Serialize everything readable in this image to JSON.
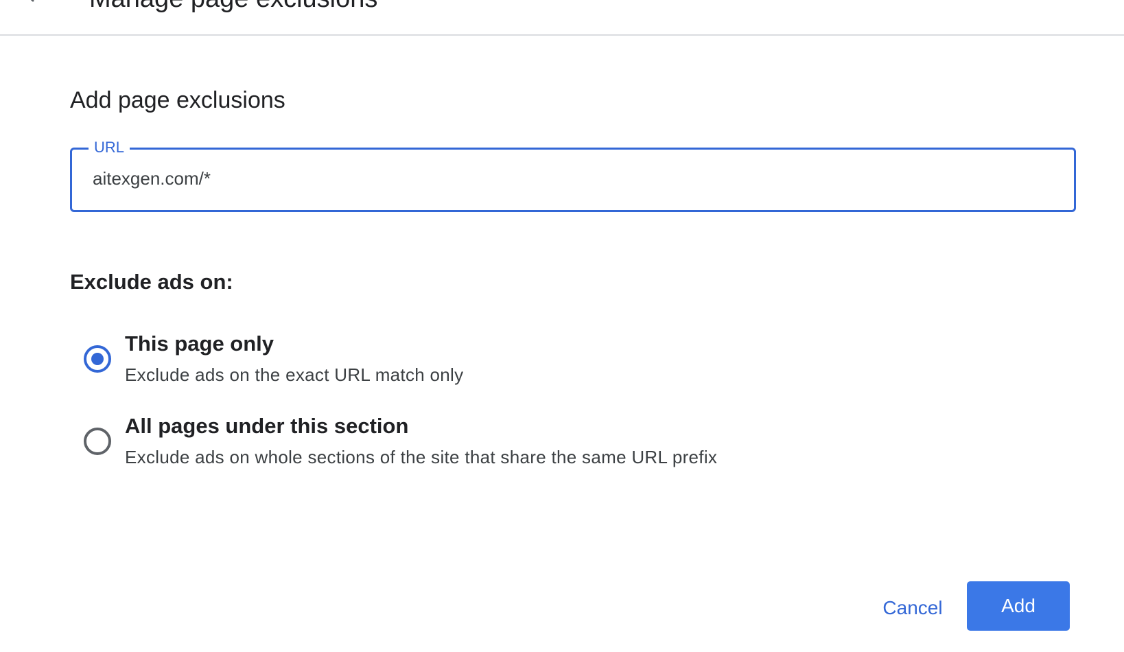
{
  "header": {
    "back_icon": "arrow-back-icon",
    "title": "Manage page exclusions"
  },
  "form": {
    "section_title": "Add page exclusions",
    "url_field": {
      "label": "URL",
      "value": "aitexgen.com/*"
    },
    "exclude_label": "Exclude ads on:",
    "options": [
      {
        "title": "This page only",
        "description": "Exclude ads on the exact URL match only",
        "selected": true
      },
      {
        "title": "All pages under this section",
        "description": "Exclude ads on whole sections of the site that share the same URL prefix",
        "selected": false
      }
    ]
  },
  "actions": {
    "cancel_label": "Cancel",
    "add_label": "Add"
  },
  "colors": {
    "accent": "#3367d6",
    "primary_button": "#3b78e7",
    "divider": "#dadce0"
  }
}
